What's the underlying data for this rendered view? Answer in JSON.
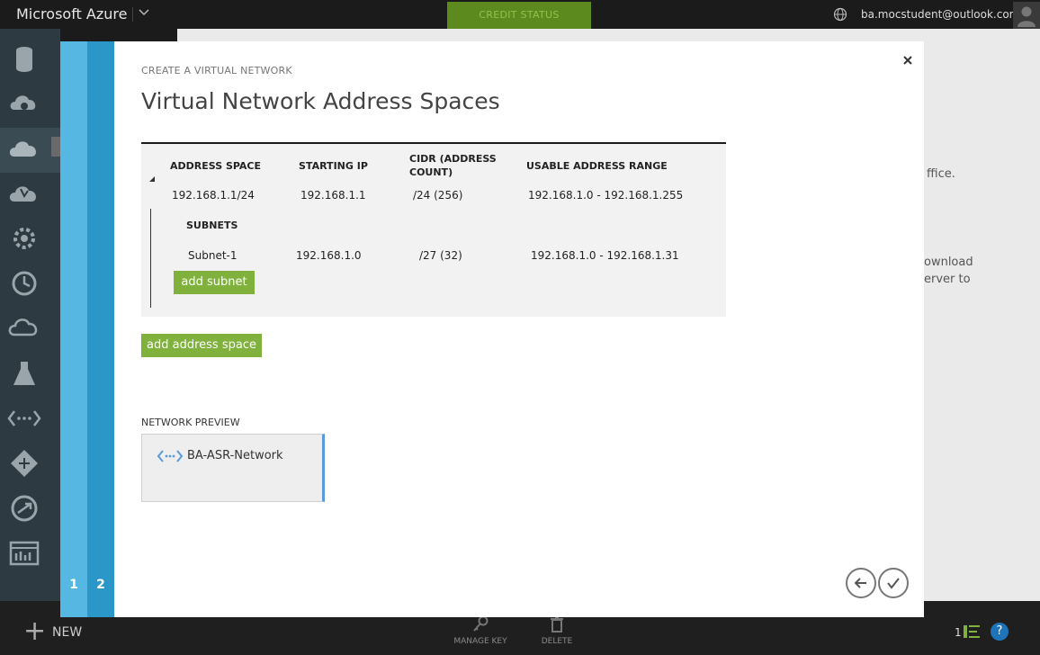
{
  "app": {
    "brand": "Microsoft Azure",
    "credit_status": "CREDIT STATUS",
    "user_email": "ba.mocstudent@outlook.com"
  },
  "background": {
    "fragments": [
      "ffice.",
      "ownload",
      "erver to"
    ]
  },
  "bottombar": {
    "new_label": "NEW",
    "commands": [
      {
        "label": "MANAGE KEY",
        "icon": "key-icon"
      },
      {
        "label": "DELETE",
        "icon": "trash-icon"
      }
    ],
    "count": "1"
  },
  "wizard": {
    "steps": [
      "1",
      "2"
    ],
    "kicker": "CREATE A VIRTUAL NETWORK",
    "title": "Virtual Network Address Spaces",
    "columns": [
      "ADDRESS SPACE",
      "STARTING IP",
      "CIDR (ADDRESS COUNT)",
      "USABLE ADDRESS RANGE"
    ],
    "address_space": {
      "address_space": "192.168.1.1/24",
      "starting_ip": "192.168.1.1",
      "cidr": "/24 (256)",
      "usable_range": "192.168.1.0 - 192.168.1.255"
    },
    "subnets_header": "SUBNETS",
    "subnets": [
      {
        "name": "Subnet-1",
        "starting_ip": "192.168.1.0",
        "cidr": "/27 (32)",
        "usable_range": "192.168.1.0 - 192.168.1.31"
      }
    ],
    "add_subnet_label": "add subnet",
    "add_address_space_label": "add address space",
    "preview_label": "NETWORK PREVIEW",
    "preview_network_name": "BA-ASR-Network"
  },
  "colors": {
    "accent_green": "#7fb13c",
    "step1_blue": "#56b8e2",
    "step2_blue": "#2b97c9",
    "preview_icon_blue": "#5b9bd5"
  }
}
